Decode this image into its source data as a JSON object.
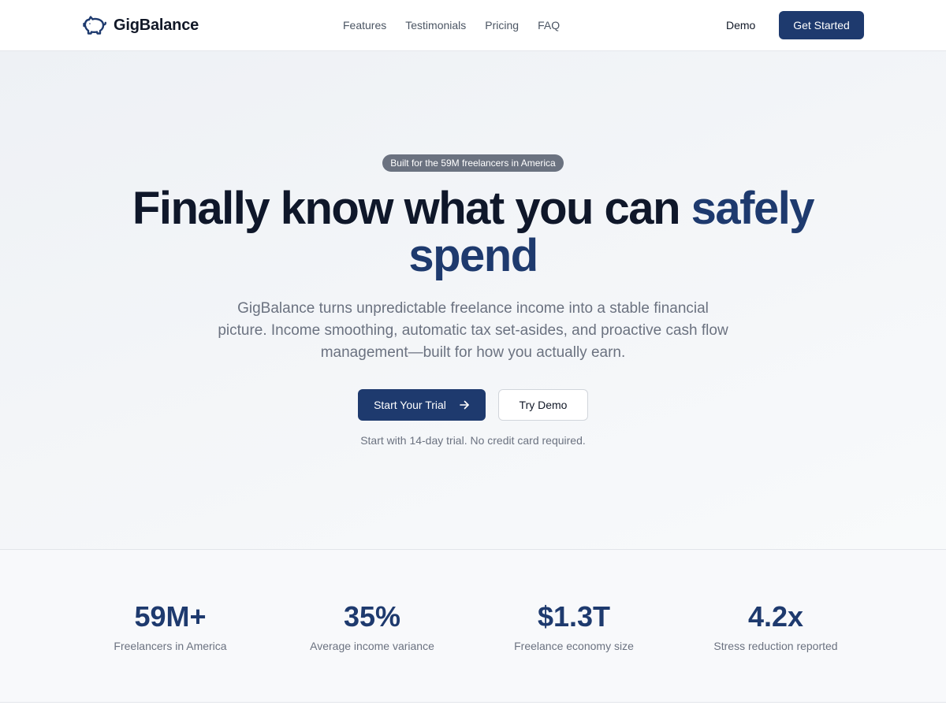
{
  "header": {
    "brand": "GigBalance",
    "logo_icon": "piggy-bank-icon",
    "nav": [
      "Features",
      "Testimonials",
      "Pricing",
      "FAQ"
    ],
    "demo_label": "Demo",
    "cta_label": "Get Started"
  },
  "hero": {
    "badge": "Built for the 59M freelancers in America",
    "headline_main": "Finally know what you can ",
    "headline_accent": "safely spend",
    "subhead": "GigBalance turns unpredictable freelance income into a stable financial picture. Income smoothing, automatic tax set-asides, and proactive cash flow management—built for how you actually earn.",
    "primary_cta": "Start Your Trial",
    "primary_cta_icon": "arrow-right-icon",
    "secondary_cta": "Try Demo",
    "note": "Start with 14-day trial. No credit card required."
  },
  "stats": [
    {
      "value": "59M+",
      "label": "Freelancers in America"
    },
    {
      "value": "35%",
      "label": "Average income variance"
    },
    {
      "value": "$1.3T",
      "label": "Freelance economy size"
    },
    {
      "value": "4.2x",
      "label": "Stress reduction reported"
    }
  ],
  "colors": {
    "brand": "#1e3a6e",
    "text": "#111827",
    "muted": "#6b7280",
    "badge": "#6b7280"
  }
}
